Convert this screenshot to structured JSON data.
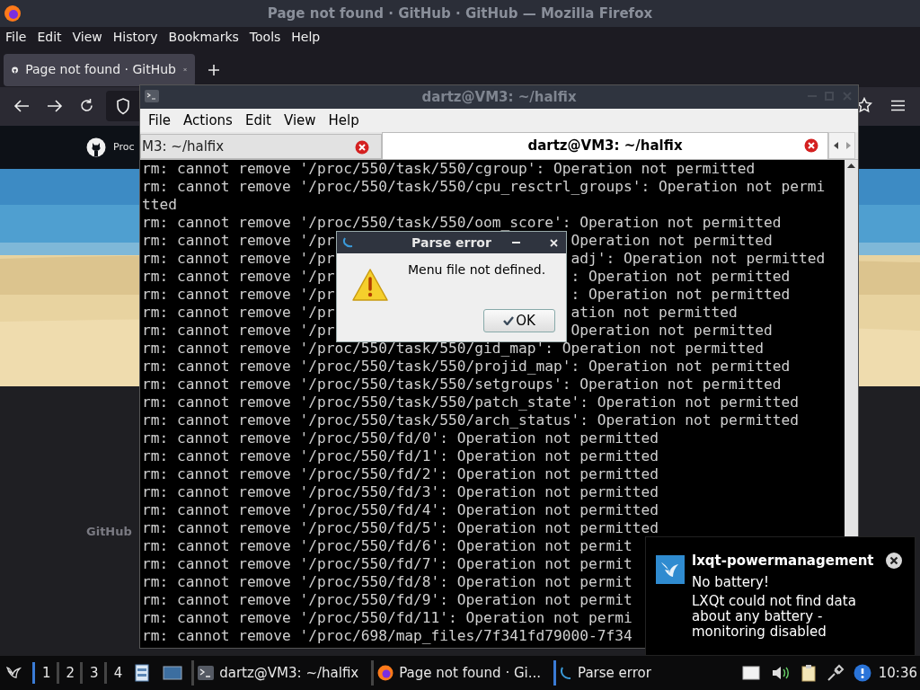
{
  "browser": {
    "title": "Page not found · GitHub · GitHub — Mozilla Firefox",
    "menu": [
      "File",
      "Edit",
      "View",
      "History",
      "Bookmarks",
      "Tools",
      "Help"
    ],
    "tabs": [
      {
        "label": "Page not found · GitHub",
        "selected": true
      }
    ],
    "page": {
      "nav_text": "Proc",
      "footer_logo": "GitHub"
    }
  },
  "terminal": {
    "title": "dartz@VM3: ~/halfix",
    "menu": [
      "File",
      "Actions",
      "Edit",
      "View",
      "Help"
    ],
    "tabs": [
      {
        "label": "M3: ~/halfix",
        "selected": false
      },
      {
        "label": "dartz@VM3: ~/halfix",
        "selected": true
      }
    ],
    "lines": [
      {
        "parts": [
          "rm: cannot remove '/proc/550/task/550/cgroup': Operation not permitted"
        ]
      },
      {
        "parts": [
          "rm: cannot remove '/proc/550/task/550/cpu_resctrl_groups': Operation not permi"
        ]
      },
      {
        "parts": [
          "tted"
        ]
      },
      {
        "parts": [
          "rm: cannot remove '/proc/550/task/550/oom_score': Operation not permitted"
        ]
      },
      {
        "parts": [
          "rm: cannot remove '/pr",
          "Operation not permitted"
        ]
      },
      {
        "parts": [
          "rm: cannot remove '/pr",
          "adj': Operation not permitted"
        ]
      },
      {
        "parts": [
          "rm: cannot remove '/pr",
          ": Operation not permitted"
        ]
      },
      {
        "parts": [
          "rm: cannot remove '/pr",
          ": Operation not permitted"
        ]
      },
      {
        "parts": [
          "rm: cannot remove '/pr",
          "ation not permitted"
        ]
      },
      {
        "parts": [
          "rm: cannot remove '/pr",
          "Operation not permitted"
        ]
      },
      {
        "parts": [
          "rm: cannot remove '/proc/550/task/550/gid_map': Operation not permitted"
        ]
      },
      {
        "parts": [
          "rm: cannot remove '/proc/550/task/550/projid_map': Operation not permitted"
        ]
      },
      {
        "parts": [
          "rm: cannot remove '/proc/550/task/550/setgroups': Operation not permitted"
        ]
      },
      {
        "parts": [
          "rm: cannot remove '/proc/550/task/550/patch_state': Operation not permitted"
        ]
      },
      {
        "parts": [
          "rm: cannot remove '/proc/550/task/550/arch_status': Operation not permitted"
        ]
      },
      {
        "parts": [
          "rm: cannot remove '/proc/550/fd/0': Operation not permitted"
        ]
      },
      {
        "parts": [
          "rm: cannot remove '/proc/550/fd/1': Operation not permitted"
        ]
      },
      {
        "parts": [
          "rm: cannot remove '/proc/550/fd/2': Operation not permitted"
        ]
      },
      {
        "parts": [
          "rm: cannot remove '/proc/550/fd/3': Operation not permitted"
        ]
      },
      {
        "parts": [
          "rm: cannot remove '/proc/550/fd/4': Operation not permitted"
        ]
      },
      {
        "parts": [
          "rm: cannot remove '/proc/550/fd/5': Operation not permitted"
        ]
      },
      {
        "parts": [
          "rm: cannot remove '/proc/550/fd/6': Operation not permit"
        ]
      },
      {
        "parts": [
          "rm: cannot remove '/proc/550/fd/7': Operation not permit"
        ]
      },
      {
        "parts": [
          "rm: cannot remove '/proc/550/fd/8': Operation not permit"
        ]
      },
      {
        "parts": [
          "rm: cannot remove '/proc/550/fd/9': Operation not permit"
        ]
      },
      {
        "parts": [
          "rm: cannot remove '/proc/550/fd/11': Operation not permi"
        ]
      },
      {
        "parts": [
          "rm: cannot remove '/proc/698/map_files/7f341fd79000-7f34"
        ]
      }
    ]
  },
  "dialog": {
    "title": "Parse error",
    "message": "Menu file not defined.",
    "button": "OK"
  },
  "notification": {
    "app": "lxqt-powermanagement",
    "summary": "No battery!",
    "body": "LXQt could not find data about any battery - monitoring disabled"
  },
  "taskbar": {
    "desktops": [
      {
        "label": "1",
        "selected": true
      },
      {
        "label": "2",
        "selected": false
      },
      {
        "label": "3",
        "selected": false
      },
      {
        "label": "4",
        "selected": false
      }
    ],
    "tasks": [
      {
        "kind": "terminal",
        "label": "dartz@VM3: ~/halfix",
        "selected": false
      },
      {
        "kind": "browser",
        "label": "Page not found · Gi...",
        "selected": false
      },
      {
        "kind": "dialog",
        "label": "Parse error",
        "selected": true
      }
    ],
    "clock": "10:36"
  }
}
